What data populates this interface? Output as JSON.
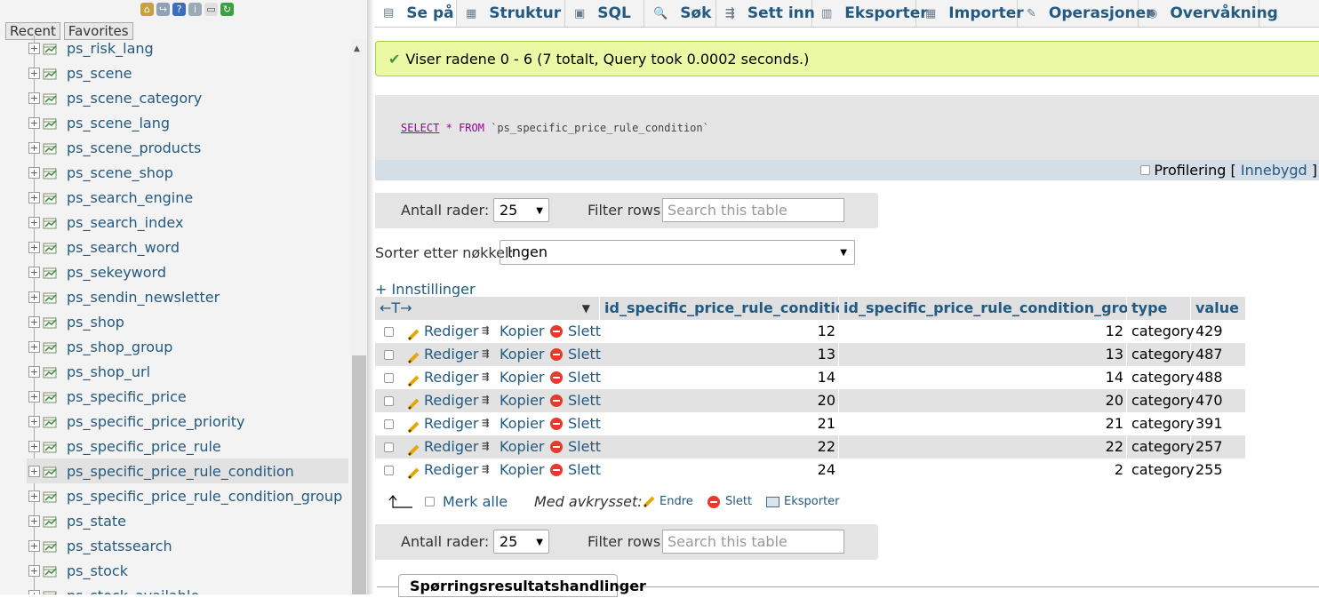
{
  "sidebar": {
    "tabs": [
      "Recent",
      "Favorites"
    ],
    "tables": [
      "ps_risk_lang",
      "ps_scene",
      "ps_scene_category",
      "ps_scene_lang",
      "ps_scene_products",
      "ps_scene_shop",
      "ps_search_engine",
      "ps_search_index",
      "ps_search_word",
      "ps_sekeyword",
      "ps_sendin_newsletter",
      "ps_shop",
      "ps_shop_group",
      "ps_shop_url",
      "ps_specific_price",
      "ps_specific_price_priority",
      "ps_specific_price_rule",
      "ps_specific_price_rule_condition",
      "ps_specific_price_rule_condition_group",
      "ps_state",
      "ps_statssearch",
      "ps_stock",
      "ps_stock_available"
    ],
    "active_index": 17,
    "expander_glyph": "+"
  },
  "tabs": [
    {
      "label": "Se på",
      "icon": "browse-icon",
      "active": true
    },
    {
      "label": "Struktur",
      "icon": "structure-icon"
    },
    {
      "label": "SQL",
      "icon": "sql-icon"
    },
    {
      "label": "Søk",
      "icon": "search-icon"
    },
    {
      "label": "Sett inn",
      "icon": "insert-icon"
    },
    {
      "label": "Eksporter",
      "icon": "export-icon"
    },
    {
      "label": "Importer",
      "icon": "import-icon"
    },
    {
      "label": "Operasjoner",
      "icon": "wrench-icon"
    },
    {
      "label": "Overvåkning",
      "icon": "eye-icon"
    }
  ],
  "success": {
    "message": "Viser radene 0 - 6 (7 totalt, Query took 0.0002 seconds.)"
  },
  "sql": {
    "select": "SELECT",
    "star": "*",
    "from": "FROM",
    "table": "`ps_specific_price_rule_condition`"
  },
  "profiling": {
    "label": "Profilering",
    "bracket_open": "[",
    "link": "Innebygd",
    "bracket_close": "]"
  },
  "nav": {
    "rows_label": "Antall rader:",
    "rows_value": "25",
    "filter_label": "Filter rows:",
    "filter_placeholder": "Search this table"
  },
  "sort": {
    "label": "Sorter etter nøkkel:",
    "value": "Ingen"
  },
  "options_link": "+ Innstillinger",
  "table": {
    "arrows": "←T→",
    "columns": [
      "id_specific_price_rule_condition",
      "id_specific_price_rule_condition_group",
      "type",
      "value"
    ],
    "actions": {
      "edit": "Rediger",
      "copy": "Kopier",
      "delete": "Slett"
    },
    "rows": [
      {
        "id": "12",
        "group": "12",
        "type": "category",
        "value": "429"
      },
      {
        "id": "13",
        "group": "13",
        "type": "category",
        "value": "487"
      },
      {
        "id": "14",
        "group": "14",
        "type": "category",
        "value": "488"
      },
      {
        "id": "20",
        "group": "20",
        "type": "category",
        "value": "470"
      },
      {
        "id": "21",
        "group": "21",
        "type": "category",
        "value": "391"
      },
      {
        "id": "22",
        "group": "22",
        "type": "category",
        "value": "257"
      },
      {
        "id": "24",
        "group": "2",
        "type": "category",
        "value": "255"
      }
    ]
  },
  "bulk": {
    "check_all": "Merk alle",
    "with_selected": "Med avkrysset:",
    "edit": "Endre",
    "delete": "Slett",
    "export": "Eksporter"
  },
  "query_ops": "Spørringsresultatshandlinger",
  "colors": {
    "link": "#235a81",
    "success_bg": "#ebf8a4",
    "success_border": "#a2d246",
    "row_alt": "#e2e2e2"
  }
}
